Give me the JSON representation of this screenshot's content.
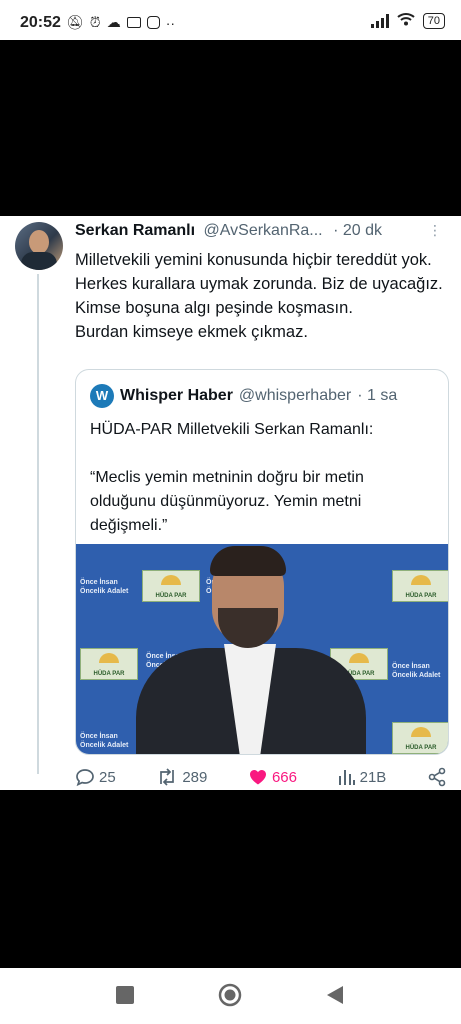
{
  "status_bar": {
    "time": "20:52",
    "battery": "70"
  },
  "tweet": {
    "author_name": "Serkan Ramanlı",
    "author_handle": "@AvSerkanRa...",
    "time_ago": "· 20 dk",
    "text": "Milletvekili yemini konusunda hiçbir tereddüt yok. Herkes kurallara uymak zorunda. Biz de uyacağız.\nKimse boşuna algı peşinde koşmasın.\nBurdan kimseye ekmek çıkmaz.",
    "quote": {
      "author_name": "Whisper Haber",
      "author_handle": "@whisperhaber",
      "time_ago": "· 1 sa",
      "text": "HÜDA-PAR Milletvekili Serkan Ramanlı:\n\n“Meclis yemin metninin doğru bir metin olduğunu düşünmüyoruz. Yemin metni değişmeli.”",
      "photo_banner_text": "HÜDA PAR",
      "photo_slogan": "Önce İnsan\nÖncelik Adalet"
    },
    "actions": {
      "replies": "25",
      "retweets": "289",
      "likes": "666",
      "views": "21B"
    }
  },
  "colors": {
    "like": "#f91880",
    "muted": "#536471",
    "border": "#cfd9de"
  }
}
